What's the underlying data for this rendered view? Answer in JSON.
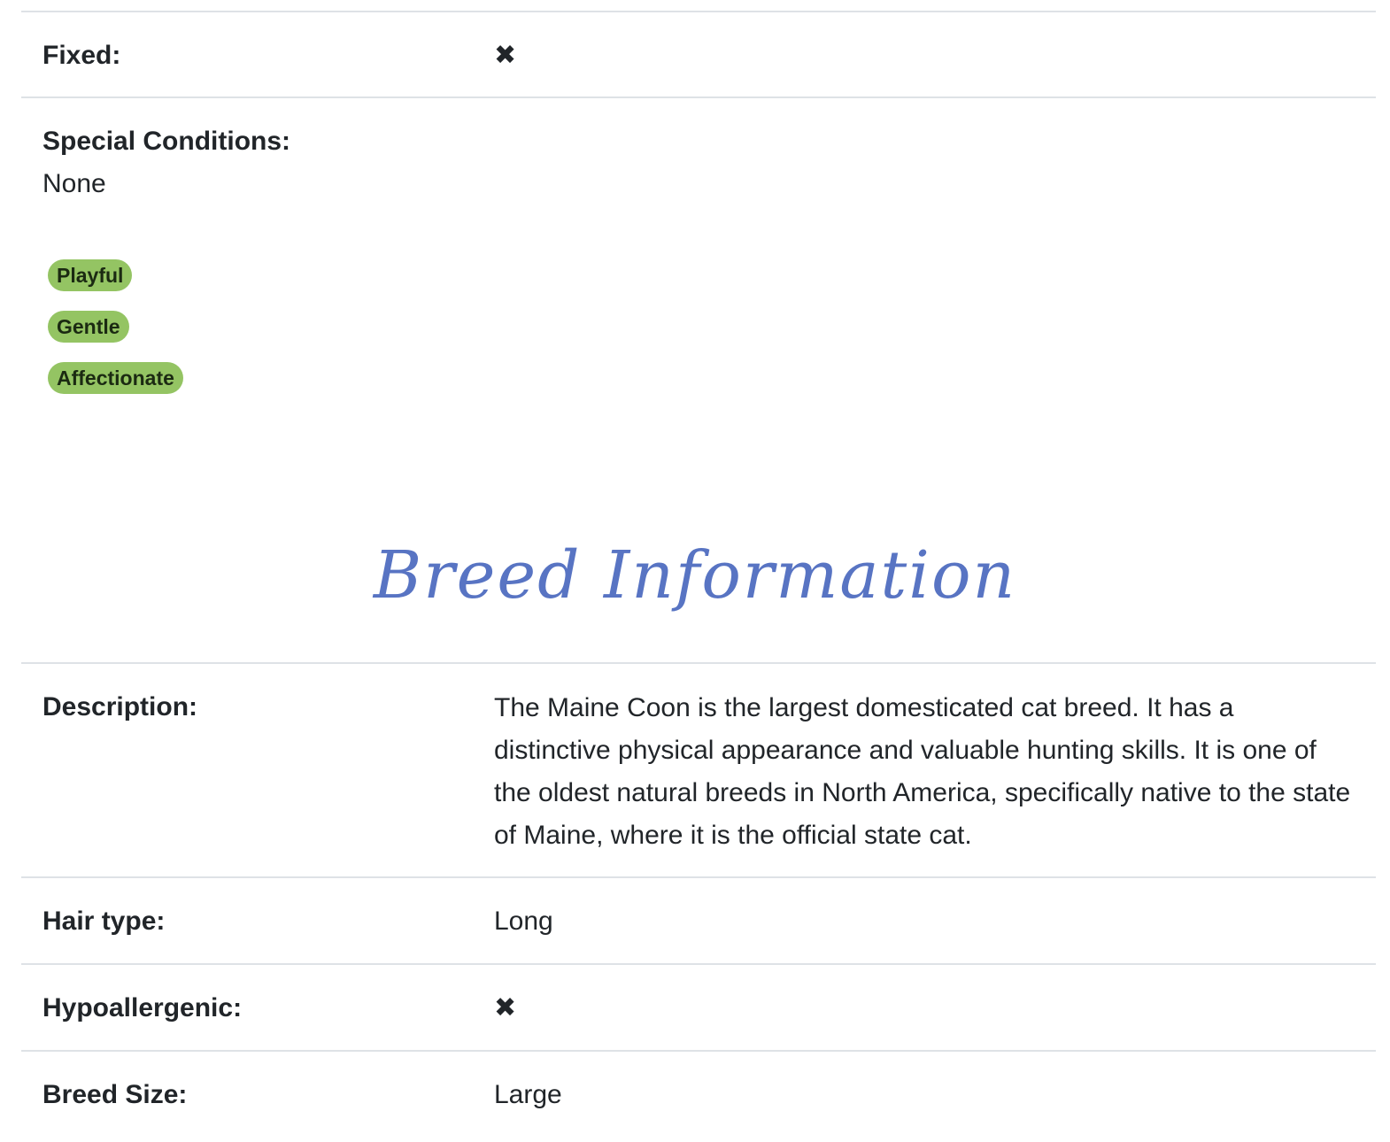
{
  "colors": {
    "badge_bg": "#94c463",
    "title_color": "#5874c3"
  },
  "rows_top": {
    "fixed_label": "Fixed:",
    "fixed_icon": "x-icon",
    "fixed_symbol": "✖",
    "special_label": "Special Conditions:",
    "special_value": "None"
  },
  "tags": [
    {
      "label": "Playful"
    },
    {
      "label": "Gentle"
    },
    {
      "label": "Affectionate"
    }
  ],
  "breed": {
    "title": "Breed Information",
    "description_label": "Description:",
    "description_value": "The Maine Coon is the largest domesticated cat breed. It has a distinctive physical appearance and valuable hunting skills. It is one of the oldest natural breeds in North America, specifically native to the state of Maine, where it is the official state cat.",
    "hair_label": "Hair type:",
    "hair_value": "Long",
    "hypo_label": "Hypoallergenic:",
    "hypo_icon": "x-icon",
    "hypo_symbol": "✖",
    "size_label": "Breed Size:",
    "size_value": "Large"
  }
}
